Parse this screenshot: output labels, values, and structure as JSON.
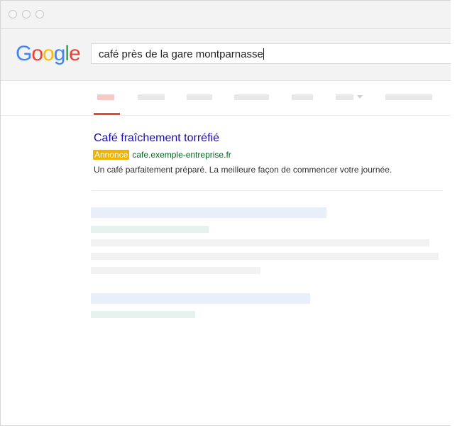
{
  "browser": {
    "window_buttons": [
      "close",
      "minimize",
      "maximize"
    ]
  },
  "google": {
    "logo_letters": [
      {
        "char": "G",
        "color": "#4285F4"
      },
      {
        "char": "o",
        "color": "#EA4335"
      },
      {
        "char": "o",
        "color": "#FBBC05"
      },
      {
        "char": "g",
        "color": "#4285F4"
      },
      {
        "char": "l",
        "color": "#34A853"
      },
      {
        "char": "e",
        "color": "#EA4335"
      }
    ]
  },
  "search": {
    "query": "café près de la gare montparnasse"
  },
  "ad": {
    "title": "Café fraîchement torréfié",
    "badge": "Annonce",
    "url": "cafe.exemple-entreprise.fr",
    "description": "Un café parfaitement préparé. La meilleure façon de commencer votre journée."
  },
  "colors": {
    "link": "#1a0dab",
    "url": "#006621",
    "badge": "#f0b400",
    "active_tab": "#dd4b39"
  }
}
